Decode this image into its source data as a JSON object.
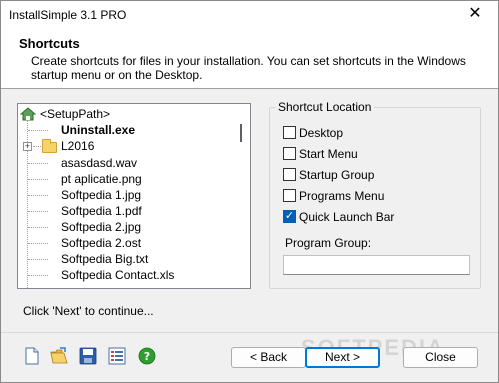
{
  "window": {
    "title": "InstallSimple 3.1 PRO",
    "close_glyph": "✕"
  },
  "header": {
    "title": "Shortcuts",
    "description": "Create shortcuts for files in your installation. You can set shortcuts in the Windows startup menu or on the Desktop."
  },
  "tree": {
    "root": "<SetupPath>",
    "items": [
      {
        "label": "Uninstall.exe",
        "bold": true
      },
      {
        "label": "L2016",
        "folder": true
      },
      {
        "label": "asasdasd.wav"
      },
      {
        "label": "pt aplicatie.png"
      },
      {
        "label": "Softpedia 1.jpg"
      },
      {
        "label": "Softpedia 1.pdf"
      },
      {
        "label": "Softpedia 2.jpg"
      },
      {
        "label": "Softpedia 2.ost"
      },
      {
        "label": "Softpedia Big.txt"
      },
      {
        "label": "Softpedia Contact.xls"
      }
    ]
  },
  "shortcut_location": {
    "label": "Shortcut Location",
    "options": [
      {
        "label": "Desktop",
        "checked": false
      },
      {
        "label": "Start Menu",
        "checked": false
      },
      {
        "label": "Startup Group",
        "checked": false
      },
      {
        "label": "Programs Menu",
        "checked": false
      },
      {
        "label": "Quick Launch Bar",
        "checked": true
      }
    ],
    "program_group_label": "Program Group:",
    "program_group_value": ""
  },
  "status": "Click 'Next' to continue...",
  "toolbar_icons": [
    "new-file-icon",
    "open-folder-icon",
    "save-disk-icon",
    "list-view-icon",
    "help-icon"
  ],
  "buttons": {
    "back": "< Back",
    "next": "Next >",
    "close": "Close"
  },
  "watermark": "SOFTPEDIA",
  "colors": {
    "accent": "#0078d7",
    "checkbox_checked": "#005fb8",
    "help_green": "#2e9e2e"
  }
}
